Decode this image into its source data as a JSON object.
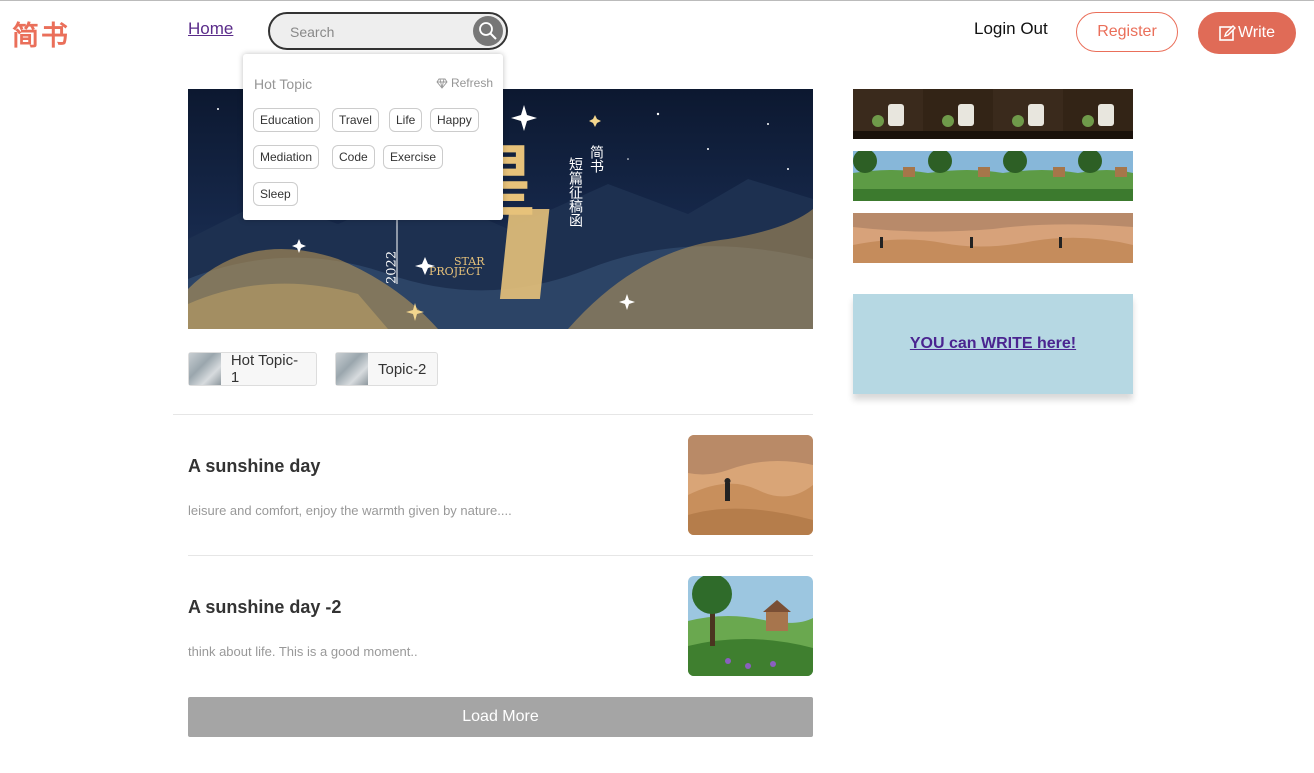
{
  "header": {
    "logo": "简书",
    "nav_home": "Home",
    "search_placeholder": "Search",
    "login_out": "Login Out",
    "register": "Register",
    "write": "Write"
  },
  "dropdown": {
    "title": "Hot Topic",
    "refresh": "Refresh",
    "tags": [
      "Education",
      "Travel",
      "Life",
      "Happy",
      "Mediation",
      "Code",
      "Exercise",
      "Sleep"
    ]
  },
  "banner": {
    "chars_big": "星",
    "chars_small": "简书",
    "subtitle": "短篇征稿函",
    "year": "2022",
    "star": "STAR",
    "project": "PROJECT"
  },
  "topics": [
    {
      "label": "Hot Topic-1"
    },
    {
      "label": "Topic-2"
    }
  ],
  "articles": [
    {
      "title": "A sunshine day",
      "abstract": "leisure and comfort, enjoy the warmth given by nature...."
    },
    {
      "title": "A sunshine day -2",
      "abstract": "think about life. This is a good moment.."
    }
  ],
  "load_more": "Load More",
  "side": {
    "write_card": "YOU can WRITE here!"
  },
  "colors": {
    "brand": "#ea6f5a",
    "write_card_bg": "#b6d8e3",
    "load_more_bg": "#a5a5a5"
  }
}
